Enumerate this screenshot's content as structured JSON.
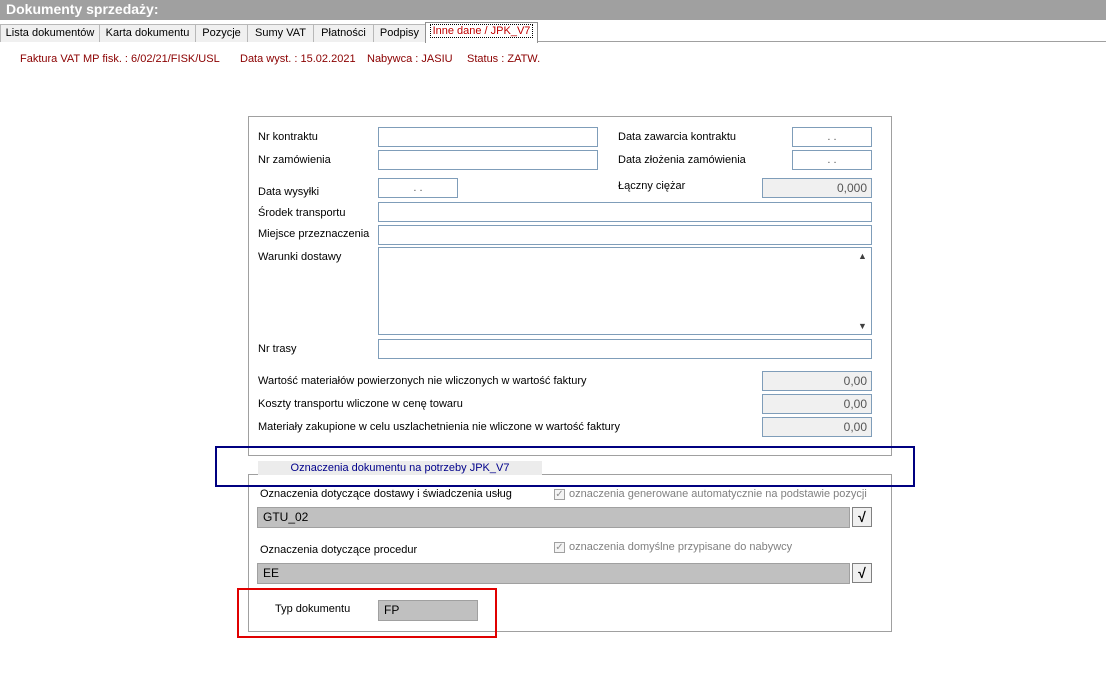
{
  "window": {
    "title": "Dokumenty sprzedaży:"
  },
  "tabs": [
    {
      "label": "Lista dokumentów"
    },
    {
      "label": "Karta dokumentu"
    },
    {
      "label": "Pozycje"
    },
    {
      "label": "Sumy VAT"
    },
    {
      "label": "Płatności"
    },
    {
      "label": "Podpisy"
    },
    {
      "label": "Inne dane / JPK_V7"
    }
  ],
  "info": {
    "invoice": "Faktura VAT MP fisk. : 6/02/21/FISK/USL",
    "date": "Data wyst. : 15.02.2021",
    "buyer": "Nabywca : JASIU",
    "status": "Status : ZATW."
  },
  "form": {
    "contract_no_label": "Nr kontraktu",
    "order_no_label": "Nr zamówienia",
    "contract_date_label": "Data zawarcia kontraktu",
    "order_date_label": "Data złożenia zamówienia",
    "date_placeholder": ". .",
    "shipping_date_label": "Data wysyłki",
    "total_weight_label": "Łączny ciężar",
    "total_weight_value": "0,000",
    "transport_label": "Środek transportu",
    "destination_label": "Miejsce przeznaczenia",
    "delivery_terms_label": "Warunki dostawy",
    "route_label": "Nr trasy",
    "materials_entrusted_label": "Wartość materiałów powierzonych nie wliczonych w wartość faktury",
    "materials_entrusted_value": "0,00",
    "transport_costs_label": "Koszty transportu wliczone w cenę towaru",
    "transport_costs_value": "0,00",
    "materials_purchased_label": "Materiały zakupione w celu uszlachetnienia nie wliczone w wartość faktury",
    "materials_purchased_value": "0,00"
  },
  "jpk": {
    "section_title": "Oznaczenia dokumentu na potrzeby JPK_V7",
    "delivery_label": "Oznaczenia dotyczące dostawy i świadczenia usług",
    "delivery_auto_label": "oznaczenia generowane automatycznie na podstawie pozycji",
    "delivery_value": "GTU_02",
    "procedures_label": "Oznaczenia dotyczące procedur",
    "procedures_default_label": "oznaczenia domyślne przypisane do nabywcy",
    "procedures_value": "EE",
    "select_button": "√",
    "checkmark": "✓",
    "doc_type_label": "Typ dokumentu",
    "doc_type_value": "FP"
  },
  "highlight_colors": {
    "blue_box": "#000080",
    "red_box": "#e00000"
  }
}
